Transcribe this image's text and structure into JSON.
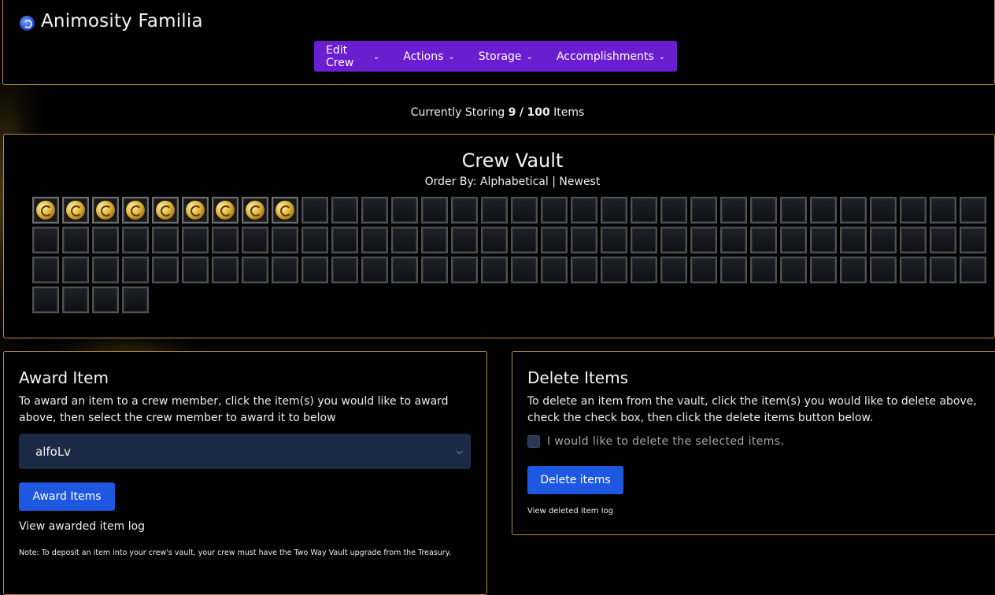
{
  "header": {
    "crew_name": "Animosity Familia",
    "logo_icon": "crew-emblem-icon",
    "nav": [
      {
        "label": "Edit Crew"
      },
      {
        "label": "Actions"
      },
      {
        "label": "Storage"
      },
      {
        "label": "Accomplishments"
      }
    ],
    "nav_color": "#6a1ed0"
  },
  "storage_status": {
    "prefix": "Currently Storing",
    "used": "9",
    "separator": "/",
    "capacity": "100",
    "suffix": "Items"
  },
  "vault": {
    "title": "Crew Vault",
    "order_by_label": "Order By:",
    "order_options": [
      "Alphabetical",
      "Newest"
    ],
    "order_divider": "|",
    "total_slots": 100,
    "filled_slots": 9,
    "item_icon": "gold-coin-icon"
  },
  "award": {
    "title": "Award Item",
    "instructions": "To award an item to a crew member, click the item(s) you would like to award above, then select the crew member to award it to below",
    "selected_member": "alfoLv",
    "button_label": "Award Items",
    "log_link": "View awarded item log",
    "note": "Note: To deposit an item into your crew's vault, your crew must have the Two Way Vault upgrade from the Treasury."
  },
  "delete": {
    "title": "Delete Items",
    "instructions": "To delete an item from the vault, click the item(s) you would like to delete above, check the check box, then click the delete items button below.",
    "checkbox_label": "I would like to delete the selected items.",
    "checkbox_checked": false,
    "button_label": "Delete items",
    "log_link": "View deleted item log"
  },
  "colors": {
    "panel_border": "#b8894a",
    "button": "#1f58e0",
    "select_bg": "#1d2a45"
  }
}
